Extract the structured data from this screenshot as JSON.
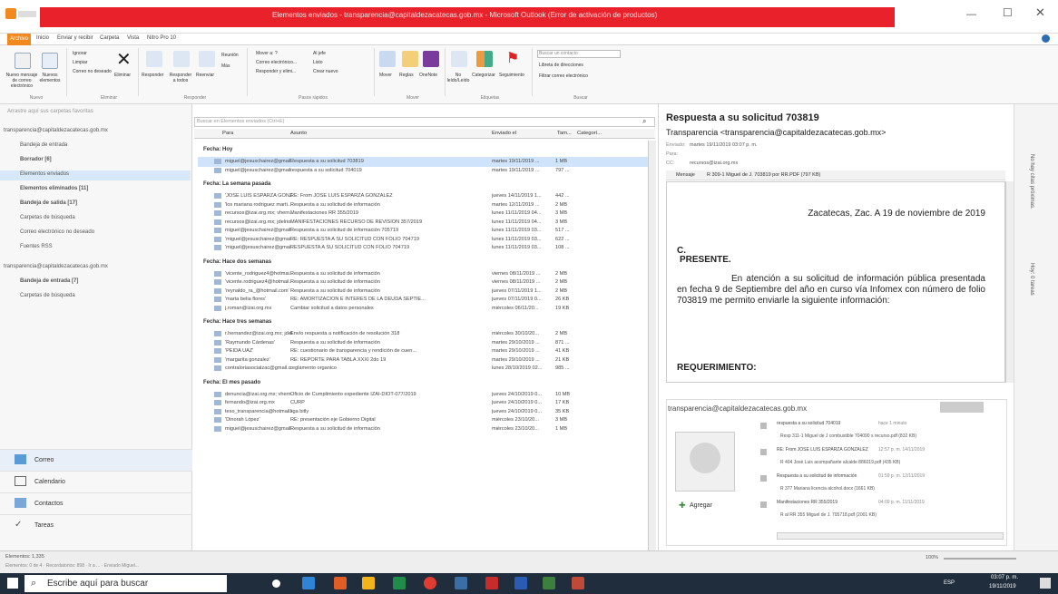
{
  "window": {
    "title": "Elementos enviados - transparencia@capitaldezacatecas.gob.mx - Microsoft Outlook (Error de activación de productos)"
  },
  "tabs": [
    "Archivo",
    "Inicio",
    "Enviar y recibir",
    "Carpeta",
    "Vista",
    "Nitro Pro 10"
  ],
  "ribbon": {
    "nuevo": [
      "Nuevo mensaje de correo electrónico",
      "Nuevos elementos"
    ],
    "nuevo_label": "Nuevo",
    "eliminar": [
      "Ignorar",
      "Limpiar",
      "Correo no deseado",
      "Eliminar"
    ],
    "eliminar_label": "Eliminar",
    "responder": [
      "Responder",
      "Responder a todos",
      "Reenviar",
      "Reunión",
      "Más"
    ],
    "responder_label": "Responder",
    "pasos": [
      "Mover a: ?",
      "Correo electrónico...",
      "Responder y elimi...",
      "Al jefe",
      "Listo",
      "Crear nuevo"
    ],
    "pasos_label": "Pasos rápidos",
    "mover": [
      "Mover",
      "Reglas",
      "OneNote"
    ],
    "mover_label": "Mover",
    "etiquetas": [
      "No leído/Leído",
      "Categorizar",
      "Seguimiento"
    ],
    "etiquetas_label": "Etiquetas",
    "buscar": [
      "Buscar un contacto",
      "Libreta de direcciones",
      "Filtrar correo electrónico"
    ],
    "buscar_label": "Buscar"
  },
  "folders": {
    "fav_hint": "Arrastre aquí sus carpetas favoritas",
    "acct1": "transparencia@capitaldezacatecas.gob.mx",
    "items": [
      "Bandeja de entrada",
      "Borrador [6]",
      "Elementos enviados",
      "Elementos eliminados [11]",
      "Bandeja de salida [17]",
      "Carpetas de búsqueda",
      "Correo electrónico no deseado",
      "Fuentes RSS"
    ],
    "acct2": "transparencia@capitaldezacatecas.gob.mx",
    "items2": [
      "Bandeja de entrada [7]",
      "Carpetas de búsqueda"
    ]
  },
  "nav": [
    "Correo",
    "Calendario",
    "Contactos",
    "Tareas"
  ],
  "list": {
    "search_placeholder": "Buscar en Elementos enviados (Ctrl+E)",
    "headers": [
      "Para",
      "Asunto",
      "Enviado el",
      "Tam...",
      "Categorí..."
    ],
    "groups": [
      {
        "label": "Fecha: Hoy",
        "rows": [
          [
            "miguel@jesuschairez@gmail...",
            "Respuesta a su solicitud 703819",
            "martes 19/11/2019 ...",
            "1 MB"
          ],
          [
            "miguel@jesuschairez@gmail...",
            "respuesta a su solicitud 704019",
            "martes 19/11/2019 ...",
            "797 ..."
          ]
        ]
      },
      {
        "label": "Fecha: La semana pasada",
        "rows": [
          [
            "'JOSE LUIS ESPARZA GONZAL...",
            "RE: From JOSE LUIS ESPARZA GONZALEZ",
            "jueves 14/11/2019 1...",
            "442 ..."
          ],
          [
            "'los mariana rodriguez marti...",
            "Respuesta a su solicitud de información",
            "martes 12/11/2019 ...",
            "2 MB"
          ],
          [
            "recursos@izai.org.mx; vhern...",
            "Manifestaciones RR 355/2019",
            "lunes 11/11/2019 04...",
            "3 MB"
          ],
          [
            "recursos@izai.org.mx; jdelrio...",
            "MANIFESTACIONES RECURSO DE REVISIÓN 357/2019",
            "lunes 11/11/2019 04...",
            "3 MB"
          ],
          [
            "miguel@jesuschairez@gmail...",
            "Respuesta a su solicitud de información 705719",
            "lunes 11/11/2019 03...",
            "517 ..."
          ],
          [
            "'miguel@jesuschairez@gmail...",
            "RE: RESPUESTA A SU SOLICITUD CON FOLIO 704719",
            "lunes 11/11/2019 03...",
            "622 ..."
          ],
          [
            "'miguel@jesuschairez@gmail...",
            "RESPUESTA A SU SOLICITUD CON FOLIO 704719",
            "lunes 11/11/2019 03...",
            "108 ..."
          ]
        ]
      },
      {
        "label": "Fecha: Hace dos semanas",
        "rows": [
          [
            "'vicente_rodriguez4@hotmai...",
            "Respuesta a su solicitud de información",
            "viernes 08/11/2019 ...",
            "2 MB"
          ],
          [
            "'vicente.rodriguez4@hotmail...",
            "Respuesta a su solicitud de información",
            "viernes 08/11/2019 ...",
            "2 MB"
          ],
          [
            "'reynaldo_ra_@hotmail.com'",
            "Respuesta a su solicitud de información",
            "jueves 07/11/2019 1...",
            "2 MB"
          ],
          [
            "'marta belia flores'",
            "RE: AMORTIZACION E INTERES DE LA DEUDA SEPTIE...",
            "jueves 07/11/2019 0...",
            "26 KB"
          ],
          [
            "j.roman@izai.org.mx",
            "Cambiar solicitud a datos personales",
            "miércoles 06/11/20...",
            "19 KB"
          ]
        ]
      },
      {
        "label": "Fecha: Hace tres semanas",
        "rows": [
          [
            "r.hernandez@izai.org.mx; jdel...",
            "Envío respuesta a notificación de resolución 318",
            "miércoles 30/10/20...",
            "2 MB"
          ],
          [
            "'Raymundo Cárdenas'",
            "Respuesta a su solicitud de información",
            "martes 29/10/2019 ...",
            "871 ..."
          ],
          [
            "'PEIDA UAZ'",
            "RE: cuestionario de transparencia y rendición de cuen...",
            "martes 29/10/2019 ...",
            "41 KB"
          ],
          [
            "'margarita gonzalez'",
            "RE: REPORTE PARA TABLA XXXI 2do 19",
            "martes 29/10/2019 ...",
            "21 KB"
          ],
          [
            "contraloriasocialzac@gmail.c...",
            "reglamento organico",
            "lunes 28/10/2019 02...",
            "985 ..."
          ]
        ]
      },
      {
        "label": "Fecha: El mes pasado",
        "rows": [
          [
            "denuncia@izai.org.mx; vhern...",
            "Oficio de Cumplimiento expediente IZAI-DIOT-077/2019",
            "jueves 24/10/2019 0...",
            "10 MB"
          ],
          [
            "fernando@izai.org.mx",
            "CURP",
            "jueves 24/10/2019 0...",
            "17 KB"
          ],
          [
            "teso_transparencia@hotmail.c...",
            "liga bitly",
            "jueves 24/10/2019 0...",
            "35 KB"
          ],
          [
            "'Dinorah López'",
            "RE: presentación eje Gobierno Digital",
            "miércoles 23/10/20...",
            "3 MB"
          ],
          [
            "miguel@jesuschairez@gmail...",
            "Respuesta a su solicitud de información",
            "miércoles 23/10/20...",
            "1 MB"
          ]
        ]
      }
    ]
  },
  "reading": {
    "subject": "Respuesta a su solicitud 703819",
    "from": "Transparencia <transparencia@capitaldezacatecas.gob.mx>",
    "sent_label": "Enviado:",
    "sent": "martes 19/11/2019 03:07 p. m.",
    "to_label": "Para:",
    "cc_label": "CC:",
    "cc": "recursos@izai.org.mx",
    "attach_label": "Mensaje",
    "attachment": "R 309-1 Miguel de J. 703819 por RR.PDF (797 KB)",
    "body_date": "Zacatecas, Zac. A 19 de noviembre de 2019",
    "body_c": "C.",
    "body_presente": "PRESENTE.",
    "body_p1": "En atención a su solicitud de información pública presentada en fecha 9 de Septiembre del año en curso vía Infomex con número de folio 703819 me permito enviarle la siguiente información:",
    "body_req": "REQUERIMIENTO:",
    "people_email": "transparencia@capitaldezacatecas.gob.mx",
    "add": "Agregar",
    "feed": [
      {
        "t": "respuesta a su solicitud 704019",
        "time": "hace 1 minuto",
        "a": "Resp 311-1 Miguel de J combustible 704090 s recurso.pdf (832 KB)"
      },
      {
        "t": "RE: From JOSE LUIS ESPARZA GONZALEZ",
        "time": "12:57 p. m. 14/11/2019",
        "a": "R 404 José Luis acompañante alcalde 886019.pdf (435 KB)"
      },
      {
        "t": "Respuesta a su solicitud de información",
        "time": "01:59 p. m. 12/11/2019",
        "a": "R 377 Mariana licencia alcohol.docx (1661 KB)"
      },
      {
        "t": "Manifestaciones RR 355/2019",
        "time": "04:09 p. m. 11/11/2019",
        "a": "R al RR 355 Miguel de J. 705718.pdf (2001 KB)"
      }
    ],
    "side": [
      "No hay citas próximas.",
      "Hoy: 0 tareas"
    ]
  },
  "status": {
    "items": "Elementos: 1,335",
    "sub": "Elementos: 0 de 4 · Recordatorios: 898 · Ir a ... · Enviado Miguel...",
    "zoom": "100%"
  },
  "taskbar": {
    "search": "Escribe aquí para buscar",
    "lang": "ESP",
    "time": "03:07 p. m.",
    "date": "19/11/2019"
  },
  "colors": {
    "accent": "#e8212a",
    "outlook_orange": "#f1891f",
    "selection": "#cfe4fb",
    "taskbar": "#1f2d3d"
  }
}
